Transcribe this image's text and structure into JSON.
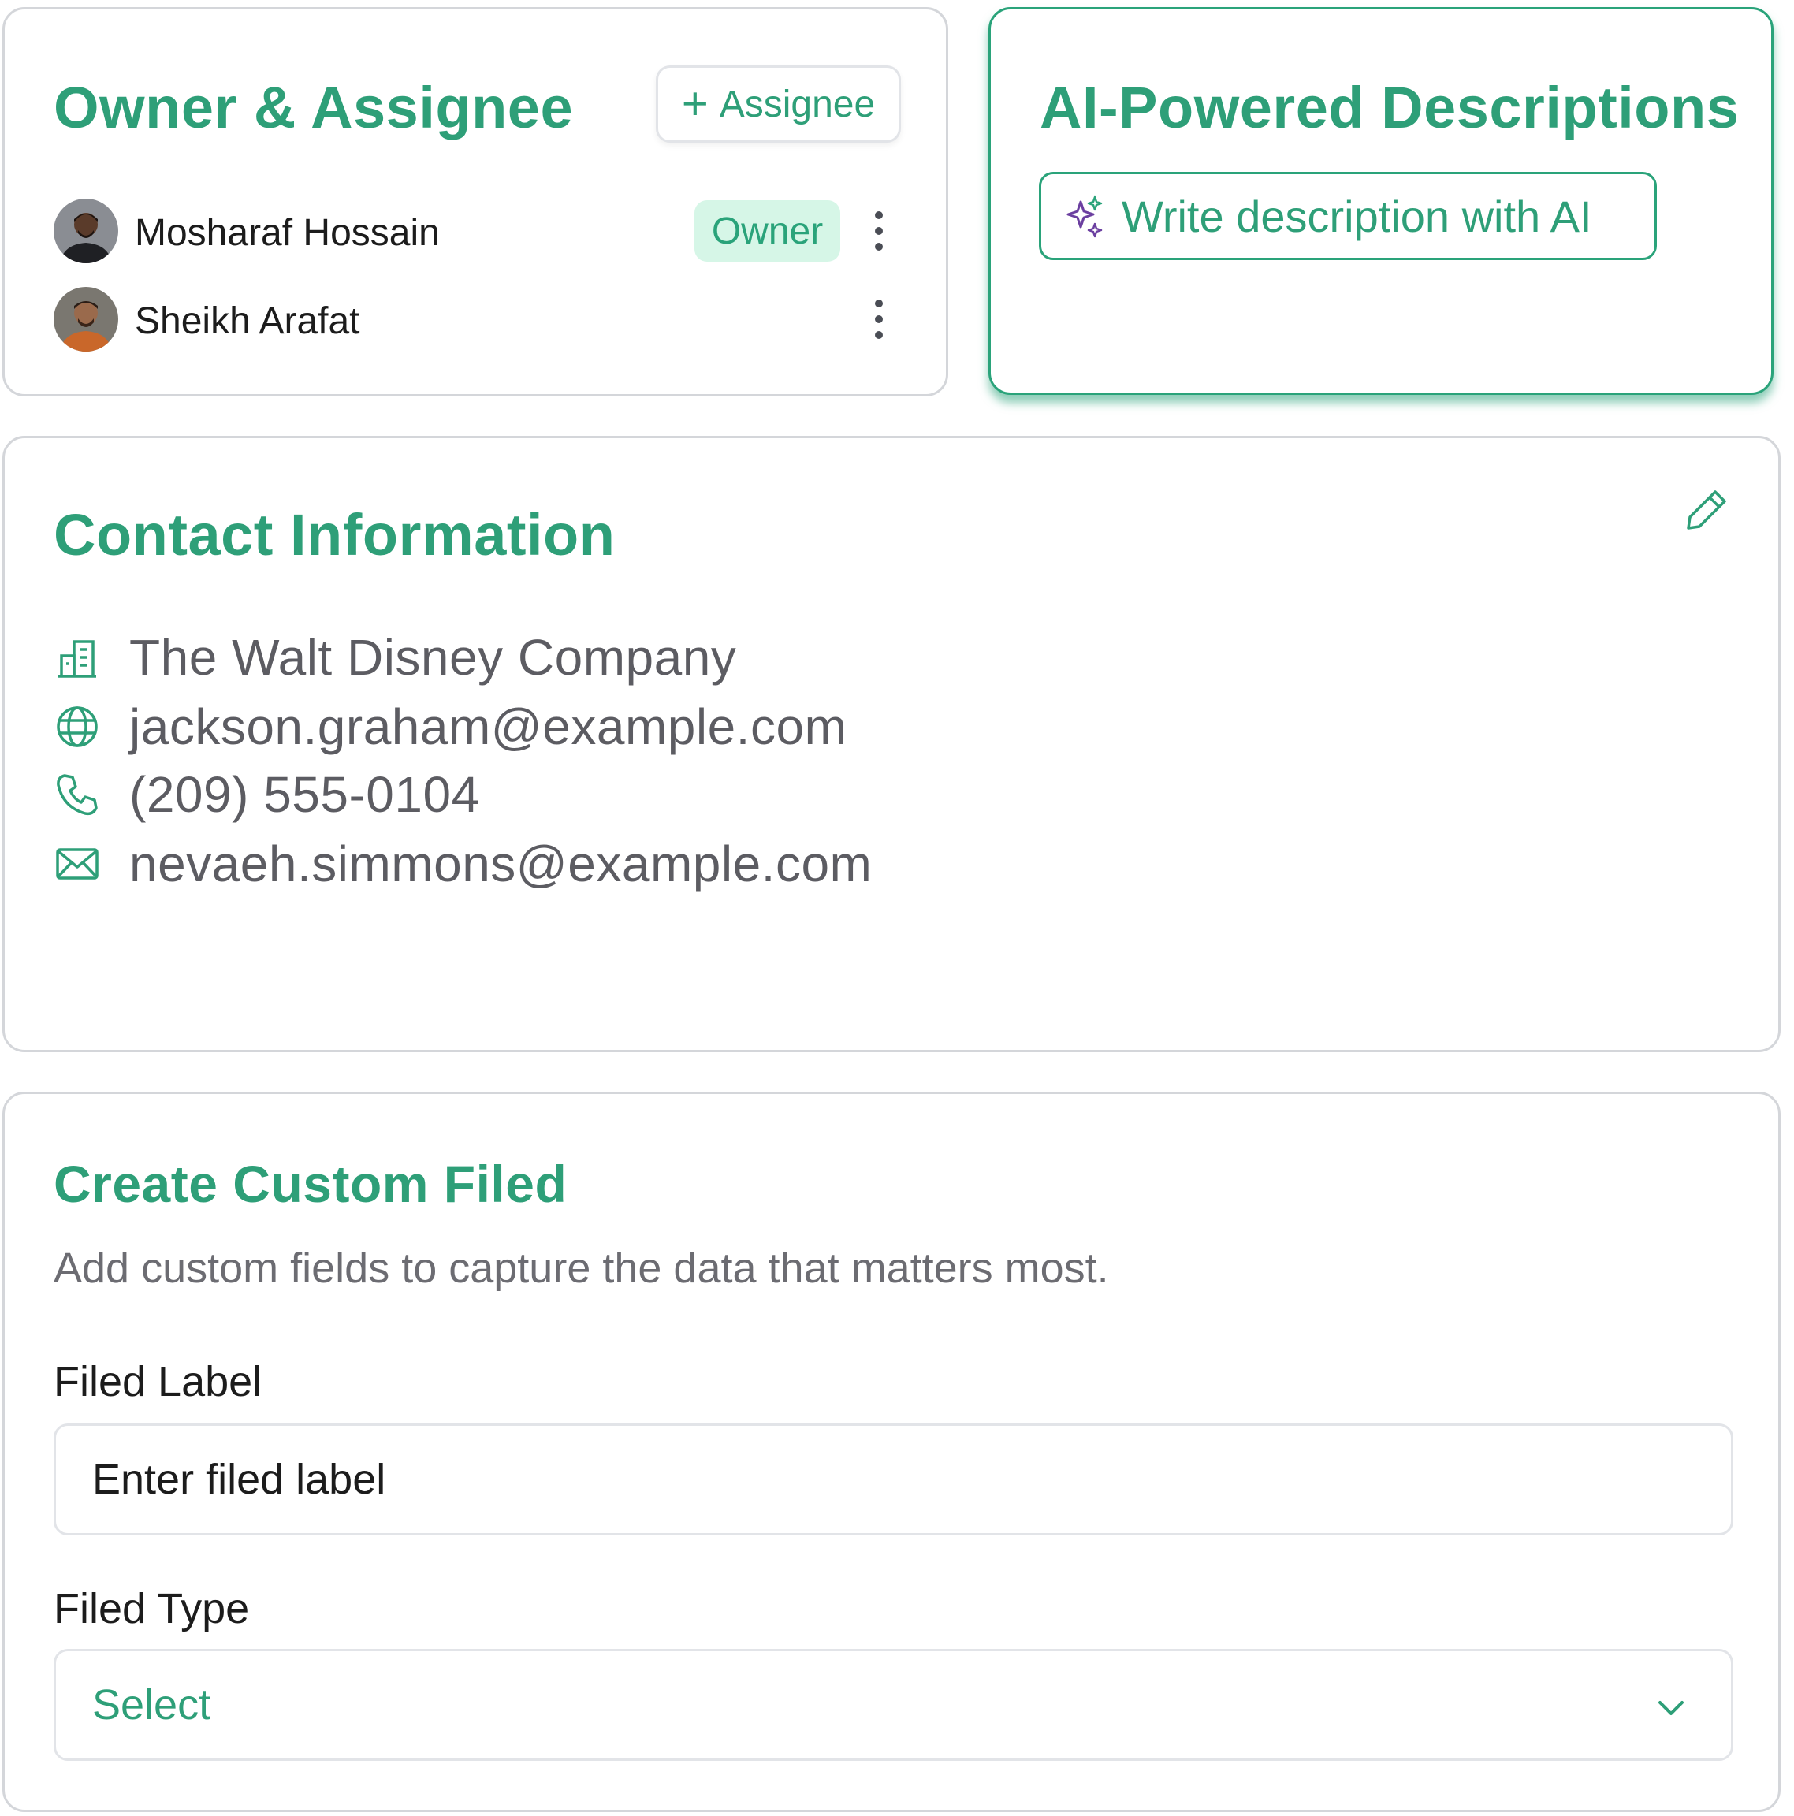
{
  "owner_card": {
    "title": "Owner & Assignee",
    "add_button_label": "Assignee",
    "members": [
      {
        "name": "Mosharaf Hossain",
        "badge": "Owner"
      },
      {
        "name": "Sheikh Arafat",
        "badge": ""
      }
    ]
  },
  "ai_card": {
    "title": "AI-Powered Descriptions",
    "button_label": "Write description with AI"
  },
  "contact_card": {
    "title": "Contact Information",
    "items": [
      {
        "icon": "building-icon",
        "text": "The Walt Disney Company"
      },
      {
        "icon": "globe-icon",
        "text": "jackson.graham@example.com"
      },
      {
        "icon": "phone-icon",
        "text": "(209) 555-0104"
      },
      {
        "icon": "mail-icon",
        "text": "nevaeh.simmons@example.com"
      }
    ]
  },
  "custom_field_card": {
    "title": "Create Custom Filed",
    "description": "Add custom fields to capture the data that matters most.",
    "label_field": {
      "label": "Filed Label",
      "placeholder": "Enter filed label",
      "value": ""
    },
    "type_field": {
      "label": "Filed Type",
      "selected": "Select"
    }
  },
  "colors": {
    "accent": "#2e9f78",
    "accent_border": "#2aa37a",
    "badge_bg": "#d6f6e7",
    "card_border": "#d4d6da",
    "muted_text": "#5c5c62",
    "ai_sparkle": "#6b3fa0"
  }
}
